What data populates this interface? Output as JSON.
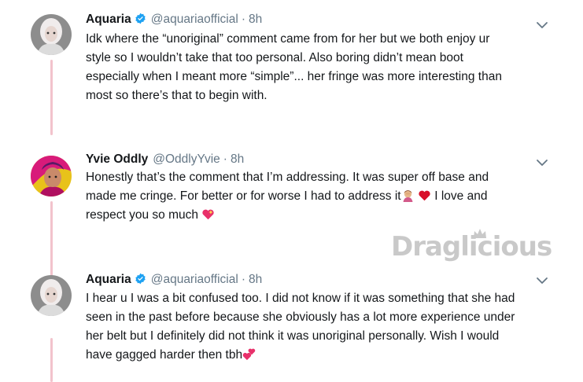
{
  "watermark": "Draglicious",
  "colors": {
    "thread_line": "#f2c3cc",
    "verified": "#1da1f2",
    "meta": "#657786",
    "text": "#14171a"
  },
  "tweets": [
    {
      "name": "Aquaria",
      "verified": true,
      "handle": "@aquariaofficial",
      "separator": "·",
      "time": "8h",
      "lines": [
        "Idk where the “unoriginal” comment came from for her but we both enjoy ur",
        "style so I wouldn’t take that too personal. Also boring didn’t mean boot",
        "especially when I meant more “simple”... her fringe was more interesting than",
        "most so there’s that to begin with."
      ],
      "avatar_icon": "avatar-aquaria"
    },
    {
      "name": "Yvie Oddly",
      "verified": false,
      "handle": "@OddlyYvie",
      "separator": "·",
      "time": "8h",
      "lines": [
        "Honestly that’s the comment that I’m addressing. It was super off base and",
        "made me cringe. For better or for worse I had to address it",
        "I love and",
        "respect you so much"
      ],
      "emojis": [
        "woman-facepalming-emoji",
        "red-heart-emoji",
        "sparkling-heart-emoji"
      ],
      "avatar_icon": "avatar-yvie"
    },
    {
      "name": "Aquaria",
      "verified": true,
      "handle": "@aquariaofficial",
      "separator": "·",
      "time": "8h",
      "lines": [
        "I hear u I was a bit confused too. I did not know if it was something that she had",
        "seen in the past before because she obviously has a lot more experience under",
        "her belt but I definitely did not think it was unoriginal personally. Wish I would",
        "have gagged harder then tbh"
      ],
      "emojis": [
        "two-hearts-emoji"
      ],
      "avatar_icon": "avatar-aquaria"
    }
  ]
}
